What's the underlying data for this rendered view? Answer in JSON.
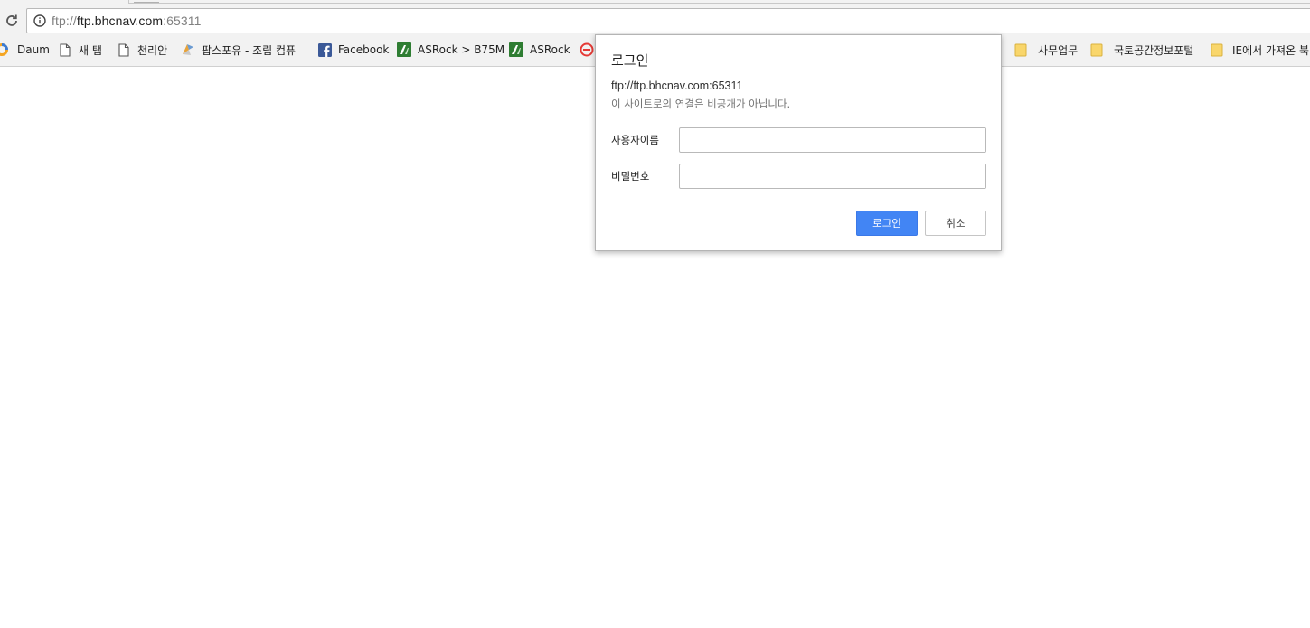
{
  "browser": {
    "url_host": "ftp://ftp.bhcnav.com",
    "url_port": ":65311",
    "url_scheme": "ftp://",
    "url_host_only": "ftp.bhcnav.com"
  },
  "bookmarks": [
    {
      "label": "Daum",
      "icon": "daum-logo-icon"
    },
    {
      "label": "새 탭",
      "icon": "page-icon"
    },
    {
      "label": "천리안",
      "icon": "page-icon"
    },
    {
      "label": "팝스포유 - 조립 컴퓨",
      "icon": "popsforyou-icon"
    },
    {
      "label": "Facebook",
      "icon": "facebook-icon"
    },
    {
      "label": "ASRock > B75M",
      "icon": "asrock-icon"
    },
    {
      "label": "ASRock",
      "icon": "asrock-icon"
    },
    {
      "label": "",
      "icon": "no-entry-icon"
    },
    {
      "label": "사무업무",
      "icon": "folder-icon"
    },
    {
      "label": "국토공간정보포털",
      "icon": "folder-icon"
    },
    {
      "label": "IE에서 가져온 북",
      "icon": "folder-icon"
    }
  ],
  "dialog": {
    "title": "로그인",
    "origin": "ftp://ftp.bhcnav.com:65311",
    "warning": "이 사이트로의 연결은 비공개가 아닙니다.",
    "username_label": "사용자이름",
    "username_value": "",
    "password_label": "비밀번호",
    "password_value": "",
    "login_label": "로그인",
    "cancel_label": "취소"
  },
  "colors": {
    "accent": "#4285f4",
    "facebook": "#3b5998",
    "asrock": "#2e7d32",
    "folder": "#f9d66b"
  }
}
